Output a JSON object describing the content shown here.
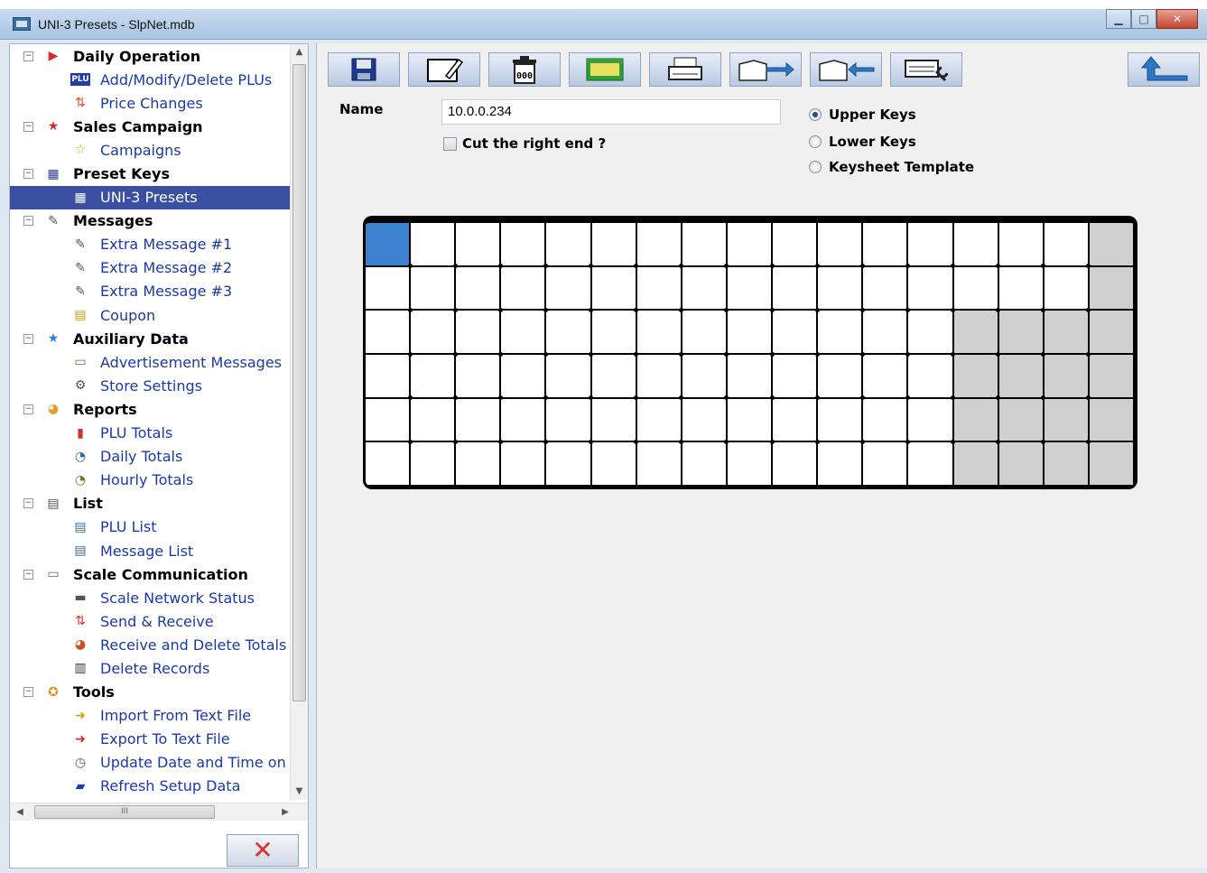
{
  "window": {
    "title": "UNI-3 Presets - SlpNet.mdb",
    "buttons": [
      "minimize",
      "maximize",
      "close"
    ]
  },
  "tree": {
    "items": [
      {
        "kind": "group",
        "label": "Daily Operation",
        "icon": "play-icon",
        "glyph": "▶",
        "color": "#d62b2b"
      },
      {
        "kind": "child",
        "label": "Add/Modify/Delete PLUs",
        "icon": "plu-icon",
        "glyph": "PLU",
        "color": "#1f3fa0"
      },
      {
        "kind": "child",
        "label": "Price Changes",
        "icon": "price-change-icon",
        "glyph": "⇅",
        "color": "#c9541f"
      },
      {
        "kind": "group",
        "label": "Sales Campaign",
        "icon": "red-star-icon",
        "glyph": "★",
        "color": "#d62b2b"
      },
      {
        "kind": "child",
        "label": "Campaigns",
        "icon": "yellow-star-icon",
        "glyph": "☆",
        "color": "#d9a600"
      },
      {
        "kind": "group",
        "label": "Preset Keys",
        "icon": "preset-keys-icon",
        "glyph": "▦",
        "color": "#2a3a8a"
      },
      {
        "kind": "child",
        "label": "UNI-3 Presets",
        "icon": "uni3-presets-icon",
        "glyph": "▦",
        "color": "#ffffff",
        "selected": true
      },
      {
        "kind": "group",
        "label": "Messages",
        "icon": "messages-icon",
        "glyph": "✎",
        "color": "#555555"
      },
      {
        "kind": "child",
        "label": "Extra Message #1",
        "icon": "message-icon",
        "glyph": "✎",
        "color": "#555555"
      },
      {
        "kind": "child",
        "label": "Extra Message #2",
        "icon": "message-icon",
        "glyph": "✎",
        "color": "#555555"
      },
      {
        "kind": "child",
        "label": "Extra Message #3",
        "icon": "message-icon",
        "glyph": "✎",
        "color": "#555555"
      },
      {
        "kind": "child",
        "label": "Coupon",
        "icon": "coupon-icon",
        "glyph": "▤",
        "color": "#c9a400"
      },
      {
        "kind": "group",
        "label": "Auxiliary Data",
        "icon": "blue-star-icon",
        "glyph": "★",
        "color": "#2c7fd6"
      },
      {
        "kind": "child",
        "label": "Advertisement Messages",
        "icon": "advertisement-icon",
        "glyph": "▭",
        "color": "#7a6a30"
      },
      {
        "kind": "child",
        "label": "Store Settings",
        "icon": "store-settings-icon",
        "glyph": "⚙",
        "color": "#555555"
      },
      {
        "kind": "group",
        "label": "Reports",
        "icon": "pie-chart-icon",
        "glyph": "◕",
        "color": "#e0a020"
      },
      {
        "kind": "child",
        "label": "PLU Totals",
        "icon": "bar-chart-icon",
        "glyph": "▮",
        "color": "#c0392b"
      },
      {
        "kind": "child",
        "label": "Daily Totals",
        "icon": "daily-totals-icon",
        "glyph": "◔",
        "color": "#2a6ab0"
      },
      {
        "kind": "child",
        "label": "Hourly Totals",
        "icon": "hourly-totals-icon",
        "glyph": "◔",
        "color": "#8a6a20"
      },
      {
        "kind": "group",
        "label": "List",
        "icon": "list-icon",
        "glyph": "▤",
        "color": "#555555"
      },
      {
        "kind": "child",
        "label": "PLU List",
        "icon": "plu-list-icon",
        "glyph": "▤",
        "color": "#3a6ab0"
      },
      {
        "kind": "child",
        "label": "Message List",
        "icon": "message-list-icon",
        "glyph": "▤",
        "color": "#3a6ab0"
      },
      {
        "kind": "group",
        "label": "Scale Communication",
        "icon": "network-icon",
        "glyph": "▭",
        "color": "#3a6ab0"
      },
      {
        "kind": "child",
        "label": "Scale Network Status",
        "icon": "network-status-icon",
        "glyph": "▬",
        "color": "#555555"
      },
      {
        "kind": "child",
        "label": "Send & Receive",
        "icon": "send-receive-icon",
        "glyph": "⇅",
        "color": "#d62b2b"
      },
      {
        "kind": "child",
        "label": "Receive and Delete Totals F",
        "icon": "receive-delete-icon",
        "glyph": "◕",
        "color": "#d05020"
      },
      {
        "kind": "child",
        "label": "Delete Records",
        "icon": "trash-icon",
        "glyph": "▥",
        "color": "#333333"
      },
      {
        "kind": "group",
        "label": "Tools",
        "icon": "tools-icon",
        "glyph": "✪",
        "color": "#e0901a"
      },
      {
        "kind": "child",
        "label": "Import From Text File",
        "icon": "import-icon",
        "glyph": "➜",
        "color": "#c9a400"
      },
      {
        "kind": "child",
        "label": "Export To Text File",
        "icon": "export-icon",
        "glyph": "➜",
        "color": "#d62b2b"
      },
      {
        "kind": "child",
        "label": "Update Date and Time on S",
        "icon": "clock-icon",
        "glyph": "◷",
        "color": "#555555"
      },
      {
        "kind": "child",
        "label": "Refresh Setup Data",
        "icon": "refresh-icon",
        "glyph": "▰",
        "color": "#1f3fa0"
      }
    ],
    "hscroll_thumb": "III"
  },
  "toolbar": {
    "buttons": [
      {
        "name": "save-icon"
      },
      {
        "name": "edit-icon"
      },
      {
        "name": "delete-icon"
      },
      {
        "name": "grid-color-icon"
      },
      {
        "name": "print-icon"
      },
      {
        "name": "send-folder-icon"
      },
      {
        "name": "receive-folder-icon"
      },
      {
        "name": "keyboard-settings-icon"
      }
    ],
    "back": {
      "name": "back-icon"
    }
  },
  "form": {
    "name_label": "Name",
    "name_value": "10.0.0.234",
    "cut_label": "Cut the right end ?",
    "cut_checked": false,
    "radios": [
      {
        "label": "Upper Keys",
        "checked": true
      },
      {
        "label": "Lower Keys",
        "checked": false
      },
      {
        "label": "Keysheet Template",
        "checked": false
      }
    ]
  },
  "keyboard": {
    "rows": 6,
    "cols": 17,
    "selected": [
      [
        0,
        0
      ]
    ],
    "grey": [
      [
        0,
        16
      ],
      [
        1,
        16
      ],
      [
        2,
        13
      ],
      [
        2,
        14
      ],
      [
        2,
        15
      ],
      [
        2,
        16
      ],
      [
        3,
        13
      ],
      [
        3,
        14
      ],
      [
        3,
        15
      ],
      [
        3,
        16
      ],
      [
        4,
        13
      ],
      [
        4,
        14
      ],
      [
        4,
        15
      ],
      [
        4,
        16
      ],
      [
        5,
        13
      ],
      [
        5,
        14
      ],
      [
        5,
        15
      ],
      [
        5,
        16
      ]
    ],
    "colors": {
      "selected": "#3d82cf",
      "grey": "#d0d0d0",
      "empty": "#ffffff"
    }
  }
}
